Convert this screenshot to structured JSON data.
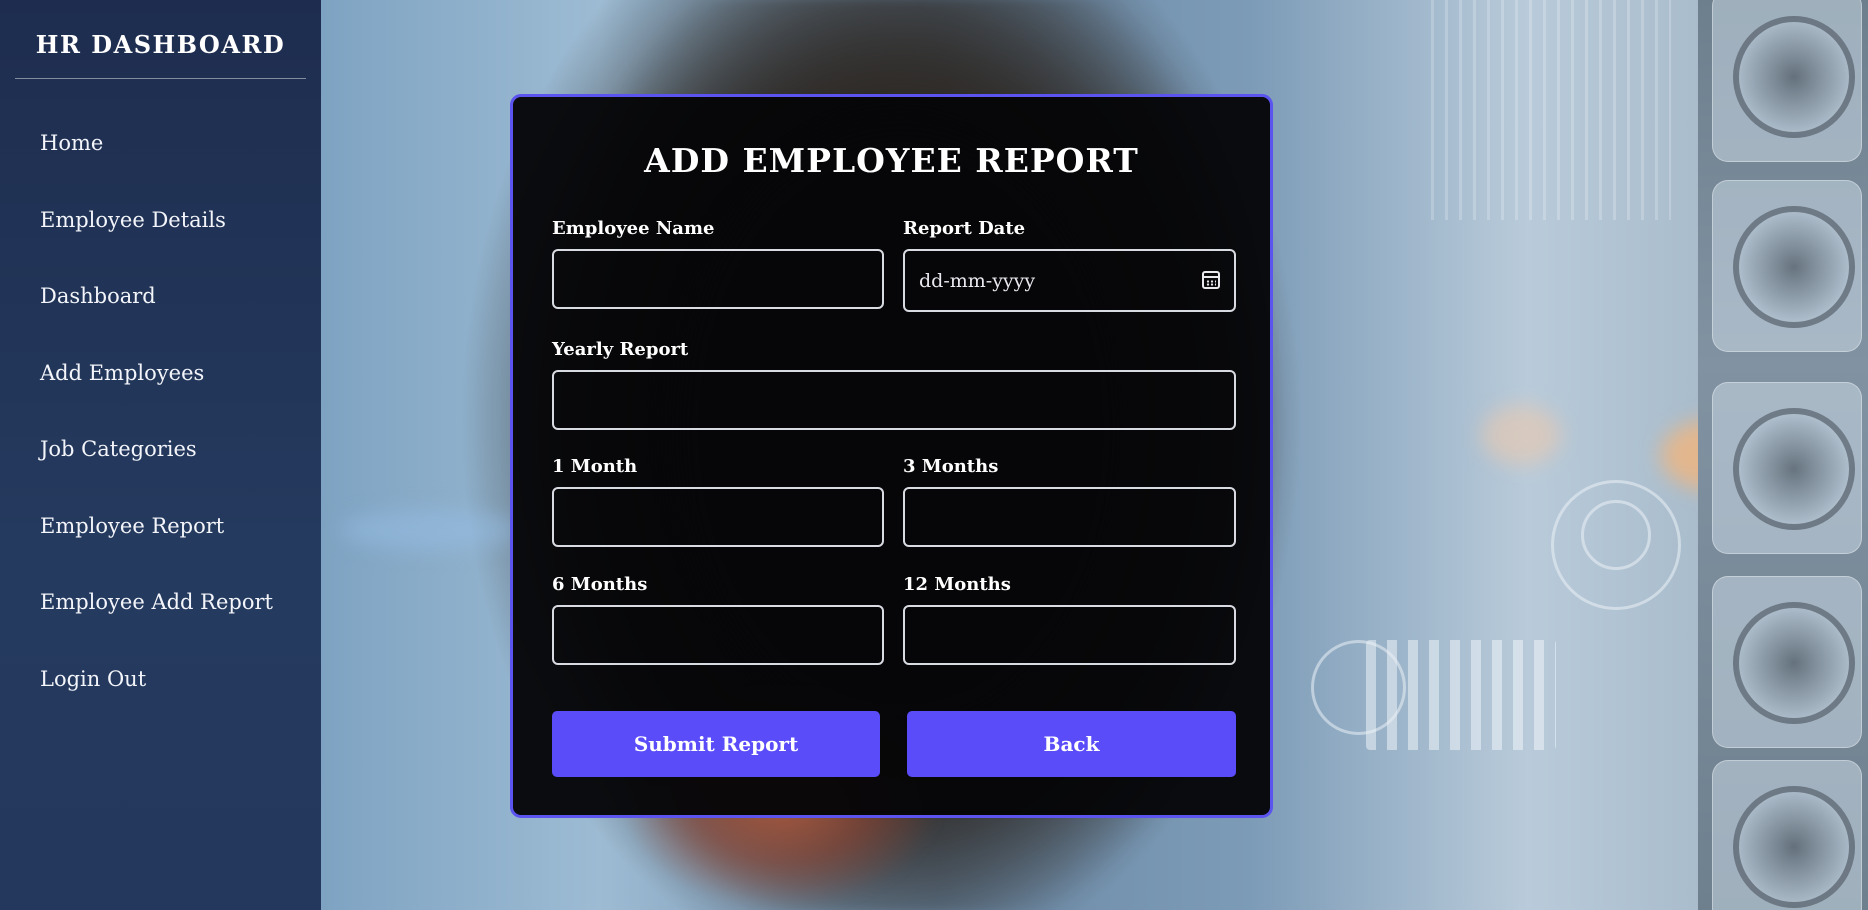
{
  "sidebar": {
    "title": "HR DASHBOARD",
    "items": [
      {
        "label": "Home"
      },
      {
        "label": "Employee Details"
      },
      {
        "label": "Dashboard"
      },
      {
        "label": "Add Employees"
      },
      {
        "label": "Job Categories"
      },
      {
        "label": "Employee Report"
      },
      {
        "label": "Employee Add Report"
      },
      {
        "label": "Login Out"
      }
    ]
  },
  "form": {
    "title": "ADD EMPLOYEE REPORT",
    "fields": {
      "employee_name": {
        "label": "Employee Name",
        "value": ""
      },
      "report_date": {
        "label": "Report Date",
        "placeholder": "dd-mm-yyyy",
        "value": ""
      },
      "yearly_report": {
        "label": "Yearly Report",
        "value": ""
      },
      "month_1": {
        "label": "1 Month",
        "value": ""
      },
      "months_3": {
        "label": "3 Months",
        "value": ""
      },
      "months_6": {
        "label": "6 Months",
        "value": ""
      },
      "months_12": {
        "label": "12 Months",
        "value": ""
      }
    },
    "buttons": {
      "submit": "Submit Report",
      "back": "Back"
    }
  },
  "icons": {
    "date_picker": "calendar-icon"
  },
  "colors": {
    "sidebar_bg": "#1e2d4f",
    "accent": "#5a4cf9",
    "card_border": "#5b54ee",
    "card_bg": "#050507"
  }
}
